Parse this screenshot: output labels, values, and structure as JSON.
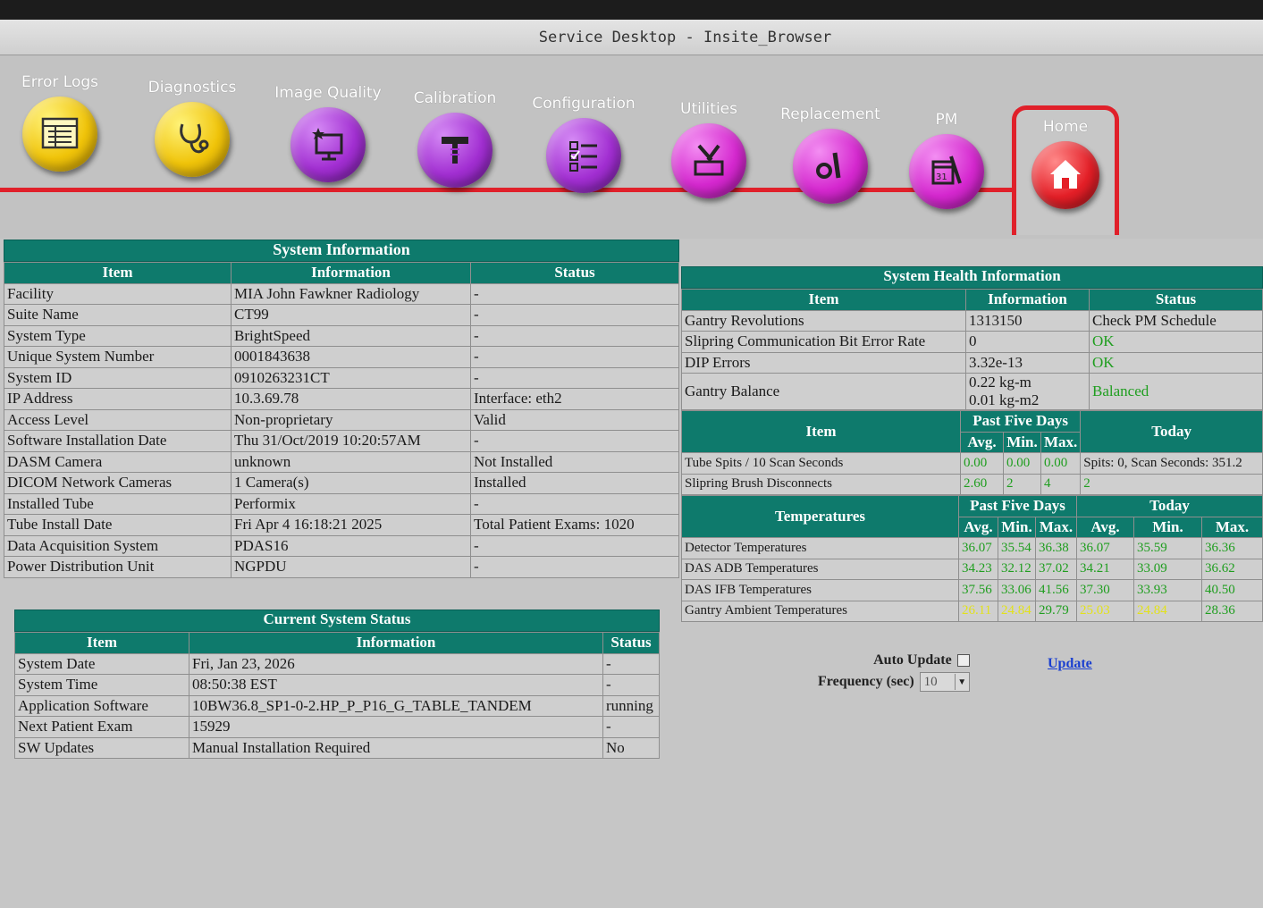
{
  "window": {
    "title": "Service Desktop - Insite_Browser"
  },
  "toolbar": {
    "items": [
      {
        "label": "Error Logs",
        "icon": "error-logs-icon"
      },
      {
        "label": "Diagnostics",
        "icon": "stethoscope-icon"
      },
      {
        "label": "Image Quality",
        "icon": "image-quality-icon"
      },
      {
        "label": "Calibration",
        "icon": "calibration-icon"
      },
      {
        "label": "Configuration",
        "icon": "configuration-icon"
      },
      {
        "label": "Utilities",
        "icon": "utilities-icon"
      },
      {
        "label": "Replacement",
        "icon": "replacement-icon"
      },
      {
        "label": "PM",
        "icon": "pm-icon"
      },
      {
        "label": "Home",
        "icon": "home-icon"
      }
    ],
    "colors": {
      "accent": "#e0202a",
      "header": "#0e7a6c"
    }
  },
  "system_info": {
    "title": "System Information",
    "headers": [
      "Item",
      "Information",
      "Status"
    ],
    "rows": [
      [
        "Facility",
        "MIA John Fawkner Radiology",
        "-"
      ],
      [
        "Suite Name",
        "CT99",
        "-"
      ],
      [
        "System Type",
        "BrightSpeed",
        "-"
      ],
      [
        "Unique System Number",
        "0001843638",
        "-"
      ],
      [
        "System ID",
        "0910263231CT",
        "-"
      ],
      [
        "IP Address",
        "10.3.69.78",
        "Interface: eth2"
      ],
      [
        "Access Level",
        "Non-proprietary",
        "Valid"
      ],
      [
        "Software Installation Date",
        "Thu 31/Oct/2019 10:20:57AM",
        "-"
      ],
      [
        "DASM Camera",
        "unknown",
        "Not Installed"
      ],
      [
        "DICOM Network Cameras",
        "1 Camera(s)",
        "Installed"
      ],
      [
        "Installed Tube",
        "Performix",
        "-"
      ],
      [
        "Tube Install Date",
        "Fri Apr 4 16:18:21 2025",
        "Total Patient Exams: 1020"
      ],
      [
        "Data Acquisition System",
        "PDAS16",
        "-"
      ],
      [
        "Power Distribution Unit",
        "NGPDU",
        "-"
      ]
    ]
  },
  "current_status": {
    "title": "Current System Status",
    "headers": [
      "Item",
      "Information",
      "Status"
    ],
    "rows": [
      [
        "System Date",
        "Fri, Jan 23, 2026",
        "-"
      ],
      [
        "System Time",
        "08:50:38 EST",
        "-"
      ],
      [
        "Application Software",
        "10BW36.8_SP1-0-2.HP_P_P16_G_TABLE_TANDEM",
        "running"
      ],
      [
        "Next Patient Exam",
        "15929",
        "-"
      ],
      [
        "SW Updates",
        "Manual Installation Required",
        "No"
      ]
    ]
  },
  "health": {
    "title": "System Health Information",
    "headers": [
      "Item",
      "Information",
      "Status"
    ],
    "rows": [
      {
        "item": "Gantry Revolutions",
        "info": "1313150",
        "info2": "",
        "status": "Check PM Schedule"
      },
      {
        "item": "Slipring Communication Bit Error Rate",
        "info": "0",
        "info2": "",
        "status": "OK"
      },
      {
        "item": "DIP Errors",
        "info": "3.32e-13",
        "info2": "",
        "status": "OK"
      },
      {
        "item": "Gantry Balance",
        "info": "0.22 kg-m",
        "info2": "0.01 kg-m2",
        "status": "Balanced"
      }
    ],
    "spits": {
      "headers": {
        "item": "Item",
        "past": "Past Five Days",
        "avg": "Avg.",
        "min": "Min.",
        "max": "Max.",
        "today": "Today"
      },
      "rows": [
        {
          "item": "Tube Spits / 10 Scan Seconds",
          "avg": "0.00",
          "min": "0.00",
          "max": "0.00",
          "today": "Spits: 0, Scan Seconds: 351.2"
        },
        {
          "item": "Slipring Brush Disconnects",
          "avg": "2.60",
          "min": "2",
          "max": "4",
          "today": "2"
        }
      ]
    },
    "temps": {
      "headers": {
        "item": "Temperatures",
        "past": "Past Five Days",
        "today": "Today",
        "avg": "Avg.",
        "min": "Min.",
        "max": "Max."
      },
      "rows": [
        {
          "item": "Detector Temperatures",
          "v": [
            "36.07",
            "35.54",
            "36.38",
            "36.07",
            "35.59",
            "36.36"
          ]
        },
        {
          "item": "DAS ADB Temperatures",
          "v": [
            "34.23",
            "32.12",
            "37.02",
            "34.21",
            "33.09",
            "36.62"
          ]
        },
        {
          "item": "DAS IFB Temperatures",
          "v": [
            "37.56",
            "33.06",
            "41.56",
            "37.30",
            "33.93",
            "40.50"
          ]
        },
        {
          "item": "Gantry Ambient Temperatures",
          "v": [
            "26.11",
            "24.84",
            "29.79",
            "25.03",
            "24.84",
            "28.36"
          ]
        }
      ]
    }
  },
  "controls": {
    "auto_update_label": "Auto Update",
    "frequency_label": "Frequency (sec)",
    "frequency_value": "10",
    "update_link": "Update"
  }
}
